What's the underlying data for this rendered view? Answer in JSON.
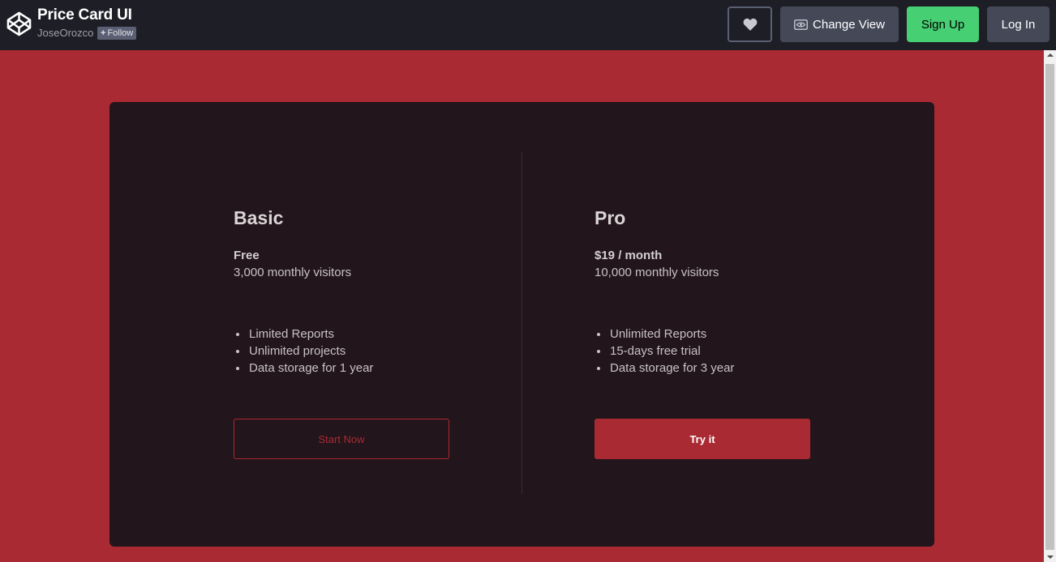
{
  "header": {
    "title": "Price Card UI",
    "author": "JoseOrozco",
    "follow_label": "Follow",
    "change_view_label": "Change View",
    "signup_label": "Sign Up",
    "login_label": "Log In"
  },
  "plans": [
    {
      "name": "Basic",
      "price": "Free",
      "visitors": "3,000 monthly visitors",
      "features": [
        "Limited Reports",
        "Unlimited projects",
        "Data storage for 1 year"
      ],
      "cta": "Start Now"
    },
    {
      "name": "Pro",
      "price": "$19 / month",
      "visitors": "10,000 monthly visitors",
      "features": [
        "Unlimited Reports",
        "15-days free trial",
        "Data storage for 3 year"
      ],
      "cta": "Try it"
    }
  ],
  "colors": {
    "page_bg": "#a92a33",
    "card_bg": "#22151b",
    "header_bg": "#1e1f26",
    "signup_green": "#47cf73",
    "accent": "#a92a33"
  },
  "icons": {
    "logo": "codepen-logo-icon",
    "like": "heart-icon",
    "view": "eye-icon",
    "follow": "plus-icon"
  }
}
